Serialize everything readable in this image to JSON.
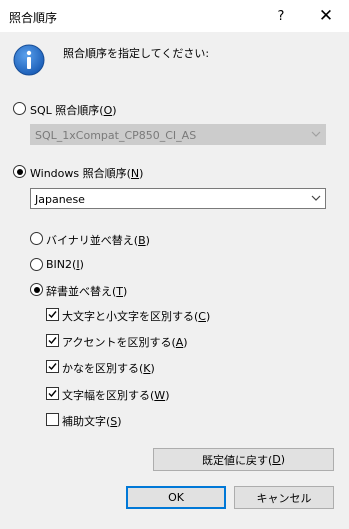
{
  "window": {
    "title": "照合順序",
    "help_glyph": "?",
    "close_glyph": "✕"
  },
  "prompt": "照合順序を指定してください:",
  "sql_collation": {
    "label": "SQL 照合順序(",
    "mnemonic": "O",
    "label_end": ")",
    "selected": false,
    "dropdown_value": "SQL_1xCompat_CP850_CI_AS"
  },
  "windows_collation": {
    "label": "Windows 照合順序(",
    "mnemonic": "N",
    "label_end": ")",
    "selected": true,
    "dropdown_value": "Japanese"
  },
  "sort_options": [
    {
      "label": "バイナリ並べ替え(",
      "mnemonic": "B",
      "end": ")",
      "selected": false
    },
    {
      "label": "BIN2(",
      "mnemonic": "I",
      "end": ")",
      "selected": false
    },
    {
      "label": "辞書並べ替え(",
      "mnemonic": "T",
      "end": ")",
      "selected": true
    }
  ],
  "checkboxes": [
    {
      "label": "大文字と小文字を区別する(",
      "mnemonic": "C",
      "end": ")",
      "checked": true
    },
    {
      "label": "アクセントを区別する(",
      "mnemonic": "A",
      "end": ")",
      "checked": true
    },
    {
      "label": "かなを区別する(",
      "mnemonic": "K",
      "end": ")",
      "checked": true
    },
    {
      "label": "文字幅を区別する(",
      "mnemonic": "W",
      "end": ")",
      "checked": true
    },
    {
      "label": "補助文字(",
      "mnemonic": "S",
      "end": ")",
      "checked": false
    }
  ],
  "buttons": {
    "reset": {
      "label": "既定値に戻す(",
      "mnemonic": "D",
      "end": ")"
    },
    "ok": "OK",
    "cancel": "キャンセル"
  },
  "colors": {
    "info_icon": "#1c5fb8",
    "dialog_bg": "#f0f0f0",
    "default_button_border": "#0078d7"
  }
}
